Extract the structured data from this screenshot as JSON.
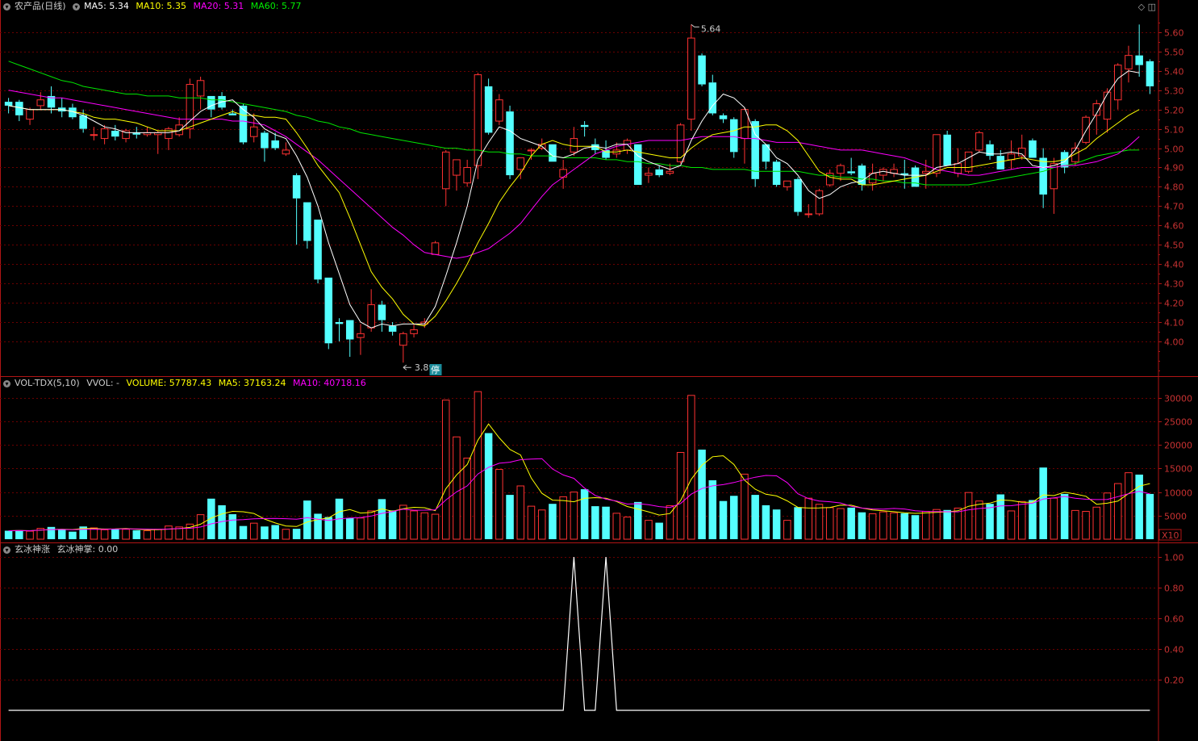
{
  "main_header": {
    "title": "农产品(日线)",
    "ma5_label": "MA5:",
    "ma5_value": "5.34",
    "ma10_label": "MA10:",
    "ma10_value": "5.35",
    "ma20_label": "MA20:",
    "ma20_value": "5.31",
    "ma60_label": "MA60:",
    "ma60_value": "5.77"
  },
  "vol_header": {
    "title": "VOL-TDX(5,10)",
    "vvol": "VVOL: -",
    "volume": "VOLUME: 57787.43",
    "ma5": "MA5: 37163.24",
    "ma10": "MA10: 40718.16"
  },
  "ind_header": {
    "title": "玄冰神涨",
    "line_label": "玄冰神掌: 0.00"
  },
  "annotations": {
    "high_label": "5.64",
    "low_label": "3.89",
    "limit_badge": "停",
    "vol_unit": "X10"
  },
  "colors": {
    "up": "#ff3232",
    "down": "#54ffff",
    "ma5": "#ffffff",
    "ma10": "#ffff00",
    "ma20": "#ff00ff",
    "ma60": "#00e600",
    "axis": "#b01515",
    "grid": "#6b0000"
  },
  "chart_data": [
    {
      "type": "candlestick",
      "yticks": [
        "5.60",
        "5.50",
        "5.40",
        "5.30",
        "5.20",
        "5.10",
        "5.00",
        "4.90",
        "4.80",
        "4.70",
        "4.60",
        "4.50",
        "4.40",
        "4.30",
        "4.20",
        "4.10",
        "4.00"
      ],
      "ylim": [
        3.82,
        5.7
      ],
      "ohlc": [
        [
          5.24,
          5.26,
          5.18,
          5.22
        ],
        [
          5.24,
          5.25,
          5.14,
          5.17
        ],
        [
          5.15,
          5.21,
          5.12,
          5.2
        ],
        [
          5.22,
          5.29,
          5.2,
          5.25
        ],
        [
          5.27,
          5.32,
          5.18,
          5.21
        ],
        [
          5.21,
          5.26,
          5.16,
          5.19
        ],
        [
          5.21,
          5.23,
          5.15,
          5.16
        ],
        [
          5.17,
          5.2,
          5.08,
          5.1
        ],
        [
          5.07,
          5.11,
          5.04,
          5.07
        ],
        [
          5.05,
          5.12,
          5.02,
          5.1
        ],
        [
          5.09,
          5.12,
          5.04,
          5.06
        ],
        [
          5.05,
          5.1,
          5.03,
          5.09
        ],
        [
          5.08,
          5.11,
          5.05,
          5.07
        ],
        [
          5.07,
          5.11,
          5.06,
          5.08
        ],
        [
          5.07,
          5.09,
          4.97,
          5.08
        ],
        [
          5.05,
          5.11,
          4.99,
          5.1
        ],
        [
          5.07,
          5.16,
          5.06,
          5.12
        ],
        [
          5.1,
          5.36,
          5.05,
          5.33
        ],
        [
          5.27,
          5.37,
          5.2,
          5.35
        ],
        [
          5.27,
          5.27,
          5.16,
          5.2
        ],
        [
          5.27,
          5.29,
          5.2,
          5.21
        ],
        [
          5.18,
          5.2,
          5.17,
          5.17
        ],
        [
          5.22,
          5.23,
          5.02,
          5.03
        ],
        [
          5.06,
          5.18,
          5.03,
          5.11
        ],
        [
          5.08,
          5.09,
          4.93,
          5.0
        ],
        [
          5.04,
          5.08,
          4.99,
          5.0
        ],
        [
          4.97,
          5.03,
          4.96,
          4.99
        ],
        [
          4.86,
          4.87,
          4.5,
          4.74
        ],
        [
          4.72,
          4.72,
          4.48,
          4.52
        ],
        [
          4.63,
          4.63,
          4.3,
          4.32
        ],
        [
          4.33,
          4.33,
          3.96,
          3.99
        ],
        [
          4.1,
          4.12,
          4.0,
          4.09
        ],
        [
          4.11,
          4.11,
          3.92,
          4.01
        ],
        [
          4.02,
          4.09,
          3.93,
          4.04
        ],
        [
          4.07,
          4.27,
          4.05,
          4.19
        ],
        [
          4.19,
          4.21,
          4.05,
          4.11
        ],
        [
          4.08,
          4.1,
          4.03,
          4.05
        ],
        [
          3.98,
          4.05,
          3.89,
          4.04
        ],
        [
          4.04,
          4.09,
          4.02,
          4.06
        ],
        [
          4.09,
          4.12,
          4.07,
          4.1
        ],
        [
          4.45,
          4.52,
          4.45,
          4.51
        ],
        [
          4.79,
          4.99,
          4.7,
          4.98
        ],
        [
          4.86,
          4.94,
          4.78,
          4.94
        ],
        [
          4.82,
          4.94,
          4.8,
          4.9
        ],
        [
          4.91,
          5.39,
          4.84,
          5.38
        ],
        [
          5.32,
          5.36,
          5.07,
          5.08
        ],
        [
          5.14,
          5.28,
          5.12,
          5.25
        ],
        [
          5.19,
          5.22,
          4.84,
          4.86
        ],
        [
          4.89,
          4.95,
          4.84,
          4.95
        ],
        [
          4.99,
          5.0,
          4.94,
          4.99
        ],
        [
          5.0,
          5.05,
          4.99,
          5.02
        ],
        [
          5.02,
          5.02,
          4.93,
          4.93
        ],
        [
          4.85,
          4.94,
          4.79,
          4.89
        ],
        [
          4.98,
          5.11,
          4.96,
          5.05
        ],
        [
          5.12,
          5.14,
          5.06,
          5.11
        ],
        [
          5.02,
          5.05,
          4.97,
          4.99
        ],
        [
          4.99,
          5.04,
          4.94,
          4.95
        ],
        [
          4.97,
          5.03,
          4.95,
          4.99
        ],
        [
          4.99,
          5.05,
          4.97,
          5.04
        ],
        [
          5.02,
          5.02,
          4.81,
          4.81
        ],
        [
          4.86,
          4.9,
          4.82,
          4.87
        ],
        [
          4.89,
          4.91,
          4.85,
          4.86
        ],
        [
          4.87,
          4.92,
          4.86,
          4.88
        ],
        [
          4.93,
          5.13,
          4.92,
          5.12
        ],
        [
          5.15,
          5.64,
          5.09,
          5.57
        ],
        [
          5.48,
          5.49,
          5.32,
          5.33
        ],
        [
          5.34,
          5.38,
          5.17,
          5.18
        ],
        [
          5.17,
          5.18,
          5.13,
          5.15
        ],
        [
          5.15,
          5.16,
          4.95,
          4.98
        ],
        [
          5.05,
          5.21,
          4.92,
          5.2
        ],
        [
          5.14,
          5.15,
          4.8,
          4.84
        ],
        [
          5.02,
          5.02,
          4.89,
          4.93
        ],
        [
          4.93,
          4.94,
          4.8,
          4.81
        ],
        [
          4.8,
          4.83,
          4.78,
          4.83
        ],
        [
          4.84,
          4.85,
          4.65,
          4.67
        ],
        [
          4.66,
          4.71,
          4.64,
          4.66
        ],
        [
          4.66,
          4.79,
          4.65,
          4.78
        ],
        [
          4.81,
          4.89,
          4.8,
          4.87
        ],
        [
          4.87,
          4.92,
          4.83,
          4.91
        ],
        [
          4.88,
          4.95,
          4.86,
          4.87
        ],
        [
          4.91,
          4.92,
          4.78,
          4.81
        ],
        [
          4.82,
          4.92,
          4.78,
          4.87
        ],
        [
          4.86,
          4.9,
          4.83,
          4.89
        ],
        [
          4.87,
          4.92,
          4.85,
          4.89
        ],
        [
          4.87,
          4.94,
          4.79,
          4.86
        ],
        [
          4.9,
          4.91,
          4.8,
          4.8
        ],
        [
          4.87,
          4.94,
          4.79,
          4.88
        ],
        [
          4.87,
          5.07,
          4.85,
          5.07
        ],
        [
          5.07,
          5.09,
          4.91,
          4.91
        ],
        [
          4.87,
          5.0,
          4.85,
          4.92
        ],
        [
          4.88,
          4.98,
          4.87,
          4.98
        ],
        [
          4.99,
          5.09,
          4.98,
          5.08
        ],
        [
          5.02,
          5.04,
          4.94,
          4.96
        ],
        [
          4.96,
          4.99,
          4.89,
          4.89
        ],
        [
          4.94,
          5.04,
          4.89,
          4.97
        ],
        [
          4.96,
          5.07,
          4.94,
          5.0
        ],
        [
          5.04,
          5.05,
          4.95,
          4.95
        ],
        [
          4.95,
          5.0,
          4.69,
          4.76
        ],
        [
          4.79,
          4.95,
          4.66,
          4.92
        ],
        [
          4.98,
          4.99,
          4.87,
          4.9
        ],
        [
          4.93,
          5.03,
          4.91,
          5.0
        ],
        [
          5.03,
          5.17,
          5.02,
          5.16
        ],
        [
          5.17,
          5.25,
          5.07,
          5.23
        ],
        [
          5.15,
          5.31,
          5.08,
          5.29
        ],
        [
          5.25,
          5.44,
          5.2,
          5.43
        ],
        [
          5.41,
          5.53,
          5.34,
          5.48
        ],
        [
          5.48,
          5.64,
          5.37,
          5.43
        ],
        [
          5.45,
          5.46,
          5.28,
          5.32
        ]
      ],
      "ma5": [
        5.22,
        5.21,
        5.2,
        5.2,
        5.2,
        5.2,
        5.19,
        5.17,
        5.14,
        5.11,
        5.1,
        5.08,
        5.08,
        5.08,
        5.08,
        5.08,
        5.09,
        5.14,
        5.19,
        5.22,
        5.24,
        5.25,
        5.2,
        5.16,
        5.1,
        5.07,
        5.05,
        4.96,
        4.85,
        4.7,
        4.51,
        4.35,
        4.19,
        4.1,
        4.07,
        4.09,
        4.08,
        4.09,
        4.09,
        4.09,
        4.18,
        4.34,
        4.51,
        4.7,
        4.94,
        5.03,
        5.11,
        5.09,
        5.05,
        5.03,
        5.01,
        4.96,
        4.95,
        4.97,
        5.0,
        5.01,
        5.0,
        5.02,
        5.02,
        4.96,
        4.93,
        4.91,
        4.89,
        4.91,
        5.04,
        5.14,
        5.22,
        5.28,
        5.26,
        5.21,
        5.07,
        5.02,
        4.95,
        4.92,
        4.86,
        4.78,
        4.74,
        4.76,
        4.8,
        4.82,
        4.83,
        4.87,
        4.88,
        4.87,
        4.86,
        4.86,
        4.86,
        4.9,
        4.91,
        4.92,
        4.95,
        4.98,
        4.97,
        4.97,
        4.98,
        4.97,
        4.91,
        4.9,
        4.91,
        4.93,
        4.99,
        5.09,
        5.18,
        5.28,
        5.36,
        5.4,
        5.39
      ],
      "ma10": [
        5.22,
        5.21,
        5.2,
        5.2,
        5.2,
        5.2,
        5.19,
        5.18,
        5.16,
        5.15,
        5.15,
        5.14,
        5.13,
        5.11,
        5.09,
        5.09,
        5.09,
        5.11,
        5.13,
        5.15,
        5.17,
        5.19,
        5.17,
        5.17,
        5.16,
        5.16,
        5.15,
        5.08,
        5.0,
        4.91,
        4.84,
        4.77,
        4.64,
        4.5,
        4.36,
        4.28,
        4.22,
        4.14,
        4.09,
        4.08,
        4.13,
        4.21,
        4.3,
        4.4,
        4.51,
        4.61,
        4.72,
        4.8,
        4.87,
        4.96,
        5.02,
        5.04,
        5.02,
        5.01,
        5.01,
        5.01,
        4.98,
        4.98,
        4.99,
        4.98,
        4.97,
        4.96,
        4.95,
        4.95,
        5.0,
        5.04,
        5.07,
        5.08,
        5.09,
        5.11,
        5.11,
        5.12,
        5.12,
        5.09,
        5.04,
        4.96,
        4.88,
        4.85,
        4.84,
        4.84,
        4.81,
        4.81,
        4.82,
        4.83,
        4.84,
        4.85,
        4.86,
        4.88,
        4.9,
        4.9,
        4.9,
        4.91,
        4.92,
        4.93,
        4.94,
        4.95,
        4.94,
        4.93,
        4.93,
        4.94,
        4.97,
        5.0,
        5.05,
        5.09,
        5.13,
        5.17,
        5.2
      ],
      "ma20": [
        5.3,
        5.29,
        5.28,
        5.27,
        5.26,
        5.26,
        5.25,
        5.24,
        5.23,
        5.22,
        5.21,
        5.2,
        5.19,
        5.18,
        5.17,
        5.16,
        5.15,
        5.15,
        5.15,
        5.15,
        5.15,
        5.14,
        5.14,
        5.13,
        5.12,
        5.09,
        5.06,
        5.02,
        4.98,
        4.94,
        4.89,
        4.84,
        4.79,
        4.74,
        4.69,
        4.64,
        4.59,
        4.55,
        4.5,
        4.46,
        4.45,
        4.44,
        4.43,
        4.44,
        4.46,
        4.48,
        4.52,
        4.56,
        4.61,
        4.68,
        4.75,
        4.81,
        4.85,
        4.89,
        4.93,
        4.97,
        4.99,
        5.01,
        5.02,
        5.03,
        5.04,
        5.04,
        5.04,
        5.04,
        5.05,
        5.06,
        5.06,
        5.06,
        5.06,
        5.05,
        5.05,
        5.04,
        5.03,
        5.03,
        5.03,
        5.02,
        5.01,
        5.0,
        4.99,
        4.99,
        4.99,
        4.98,
        4.97,
        4.96,
        4.95,
        4.93,
        4.91,
        4.89,
        4.88,
        4.87,
        4.86,
        4.86,
        4.87,
        4.88,
        4.89,
        4.9,
        4.9,
        4.9,
        4.9,
        4.91,
        4.91,
        4.92,
        4.93,
        4.95,
        4.97,
        5.01,
        5.06
      ],
      "ma60": [
        5.45,
        5.43,
        5.41,
        5.39,
        5.37,
        5.35,
        5.34,
        5.32,
        5.31,
        5.3,
        5.29,
        5.28,
        5.28,
        5.27,
        5.27,
        5.27,
        5.26,
        5.26,
        5.26,
        5.25,
        5.25,
        5.24,
        5.23,
        5.22,
        5.21,
        5.2,
        5.19,
        5.17,
        5.16,
        5.14,
        5.13,
        5.11,
        5.1,
        5.08,
        5.07,
        5.06,
        5.05,
        5.04,
        5.03,
        5.02,
        5.01,
        5.0,
        5.0,
        4.99,
        4.99,
        4.98,
        4.98,
        4.97,
        4.97,
        4.96,
        4.96,
        4.96,
        4.95,
        4.95,
        4.95,
        4.95,
        4.94,
        4.94,
        4.93,
        4.93,
        4.92,
        4.92,
        4.91,
        4.91,
        4.9,
        4.9,
        4.89,
        4.89,
        4.89,
        4.89,
        4.88,
        4.88,
        4.88,
        4.88,
        4.88,
        4.87,
        4.86,
        4.86,
        4.85,
        4.85,
        4.84,
        4.84,
        4.83,
        4.83,
        4.82,
        4.82,
        4.81,
        4.81,
        4.81,
        4.81,
        4.81,
        4.82,
        4.83,
        4.84,
        4.85,
        4.86,
        4.87,
        4.88,
        4.9,
        4.91,
        4.92,
        4.94,
        4.96,
        4.97,
        4.98,
        4.99,
        4.99
      ]
    },
    {
      "type": "bar",
      "yticks": [
        "30000",
        "25000",
        "20000",
        "15000",
        "10000",
        "5000"
      ],
      "ylim": [
        0,
        31500
      ],
      "volume": [
        1800,
        1900,
        1700,
        2300,
        2600,
        2100,
        1600,
        2700,
        2400,
        2000,
        2200,
        2100,
        1900,
        1800,
        2100,
        2800,
        2600,
        3200,
        5200,
        8600,
        7200,
        5300,
        2800,
        3400,
        2700,
        3000,
        2100,
        2200,
        8200,
        5400,
        4700,
        8600,
        4500,
        4500,
        6000,
        8500,
        6100,
        7200,
        6000,
        5600,
        5300,
        29500,
        21700,
        17200,
        31300,
        22500,
        14800,
        9400,
        11300,
        7000,
        6200,
        7500,
        9000,
        10000,
        10600,
        7000,
        6900,
        5500,
        4700,
        7900,
        4000,
        3500,
        7100,
        18400,
        30500,
        19000,
        12500,
        8100,
        9200,
        13800,
        9400,
        7200,
        6300,
        4000,
        6800,
        8700,
        7400,
        6700,
        6500,
        6700,
        5700,
        5400,
        5800,
        5600,
        5500,
        5100,
        5900,
        6300,
        6200,
        6600,
        9900,
        8100,
        7500,
        9500,
        6000,
        8000,
        8300,
        15200,
        8700,
        9600,
        6100,
        5900,
        6800,
        9800,
        11800,
        14100,
        13700,
        9600
      ]
    },
    {
      "type": "line",
      "name": "玄冰神掌",
      "yticks": [
        "1.00",
        "0.80",
        "0.60",
        "0.40",
        "0.20"
      ],
      "ylim": [
        -0.2,
        1.0
      ],
      "values": [
        0,
        0,
        0,
        0,
        0,
        0,
        0,
        0,
        0,
        0,
        0,
        0,
        0,
        0,
        0,
        0,
        0,
        0,
        0,
        0,
        0,
        0,
        0,
        0,
        0,
        0,
        0,
        0,
        0,
        0,
        0,
        0,
        0,
        0,
        0,
        0,
        0,
        0,
        0,
        0,
        0,
        0,
        0,
        0,
        0,
        0,
        0,
        0,
        0,
        0,
        0,
        0,
        0,
        1,
        0,
        0,
        1,
        0,
        0,
        0,
        0,
        0,
        0,
        0,
        0,
        0,
        0,
        0,
        0,
        0,
        0,
        0,
        0,
        0,
        0,
        0,
        0,
        0,
        0,
        0,
        0,
        0,
        0,
        0,
        0,
        0,
        0,
        0,
        0,
        0,
        0,
        0,
        0,
        0,
        0,
        0,
        0,
        0,
        0,
        0,
        0,
        0,
        0,
        0,
        0,
        0,
        0,
        0
      ]
    }
  ]
}
